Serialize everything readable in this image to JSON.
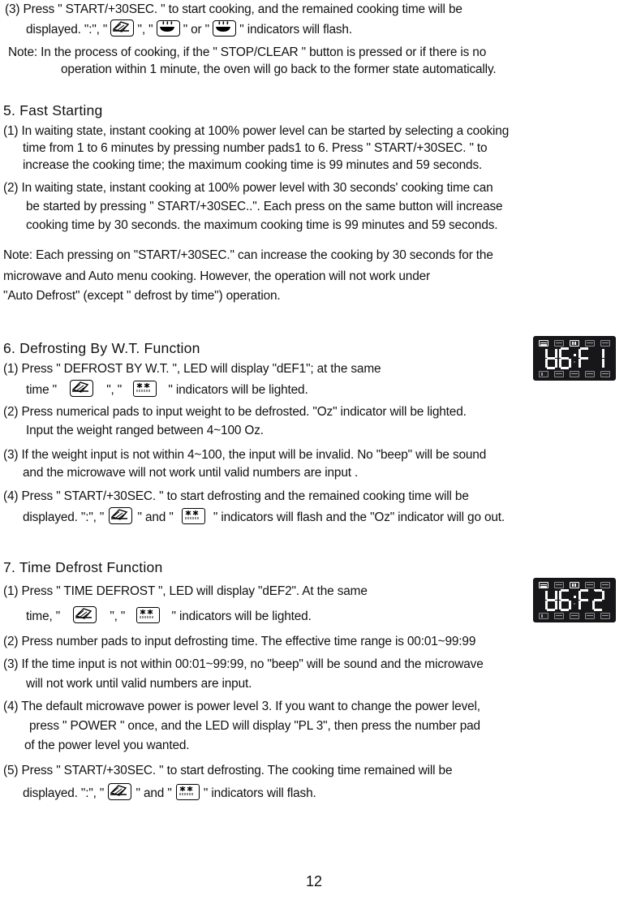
{
  "page": {
    "number": "12"
  },
  "section_prev": {
    "items": [
      {
        "id": "prev-3",
        "lines": [
          "(3) Press \" START/+30SEC. \" to start cooking, and the remained cooking time will be",
          "displayed. \":\", \"",
          "\", \"",
          "\" or \"",
          "\" indicators will flash."
        ]
      }
    ],
    "note": {
      "line1": "Note: In the process of cooking, if the \" STOP/CLEAR \" button is pressed  or if there is no",
      "line2": "operation within 1 minute,  the oven will go back to the former state automatically."
    }
  },
  "section5": {
    "heading": "5. Fast Starting",
    "items": [
      "(1) In waiting state, instant cooking at 100% power level can be started by selecting a cooking",
      "time from 1 to 6 minutes by pressing number pads1 to 6. Press \" START/+30SEC. \"  to",
      "increase the cooking time; the maximum cooking time is 99 minutes and 59 seconds.",
      "(2) In waiting state, instant cooking at 100% power level with 30 seconds' cooking time can",
      "be started by pressing \" START/+30SEC..\". Each press on the same button will increase",
      "cooking time by 30 seconds. the maximum cooking time is 99 minutes and 59 seconds."
    ],
    "note": [
      "Note: Each pressing on \"START/+30SEC.\" can increase the cooking by 30 seconds for the",
      "microwave and Auto menu cooking.  However, the operation will not work under",
      "\"Auto Defrost\" (except \" defrost by time\") operation."
    ]
  },
  "section6": {
    "heading": "6. Defrosting By W.T. Function",
    "line1a": "(1) Press \" DEFROST BY W.T. \", LED will display \"dEF1\"; at the same",
    "line1b": "time \"",
    "line1c": "\", \"",
    "line1d": "\" indicators will be lighted.",
    "line2a": "(2) Press numerical pads to input weight to be defrosted. \"Oz\" indicator will be  lighted.",
    "line2b": "Input the weight ranged between  4~100 Oz.",
    "line3a": "(3) If the weight input  is not within 4~100, the input will be invalid. No \"beep\" will be sound",
    "line3b": "and the microwave will not work until valid numbers are input .",
    "line4a": "(4) Press \" START/+30SEC. \" to start defrosting and the remained cooking time will be",
    "line4b": "displayed. \":\", \"",
    "line4c": "\" and \"",
    "line4d": "\" indicators will flash and the \"Oz\" indicator will go out.",
    "display": {
      "name": "led-display-def1",
      "digits": [
        "d",
        "E",
        "F",
        "1"
      ],
      "colon": ":"
    }
  },
  "section7": {
    "heading": "7. Time Defrost Function",
    "line1a": "(1) Press \" TIME DEFROST \",  LED will display \"dEF2\". At the same",
    "line1b": "time, \"",
    "line1c": "\", \"",
    "line1d": "\" indicators will be lighted.",
    "line2": "(2) Press number pads to input defrosting time. The effective time range is 00:01~99:99",
    "line3a": "(3) If the time input is not within 00:01~99:99, no \"beep\" will be sound and the microwave",
    "line3b": "will not work until valid numbers are input.",
    "line4a": "(4) The default microwave power is power level 3. If you want to change the power level,",
    "line4b": "press \" POWER \" once, and the LED will display \"PL 3\", then press the number pad",
    "line4c": "of  the power level you wanted.",
    "line5a": "(5) Press \" START/+30SEC. \" to start defrosting. The cooking time remained will be",
    "line5b": "displayed. \":\", \"",
    "line5c": "\" and \"",
    "line5d": "\" indicators will flash.",
    "display": {
      "name": "led-display-def2",
      "digits": [
        "d",
        "E",
        "F",
        "2"
      ],
      "colon": ":"
    }
  },
  "icons": {
    "plate": "microwave-plate-icon",
    "bowl": "steam-bowl-icon",
    "snowflake": "snowflake-defrost-icon"
  },
  "colors": {
    "text": "#111111",
    "led_background": "#17171a",
    "led_segment": "#fbfbfb",
    "page_background": "#ffffff"
  }
}
